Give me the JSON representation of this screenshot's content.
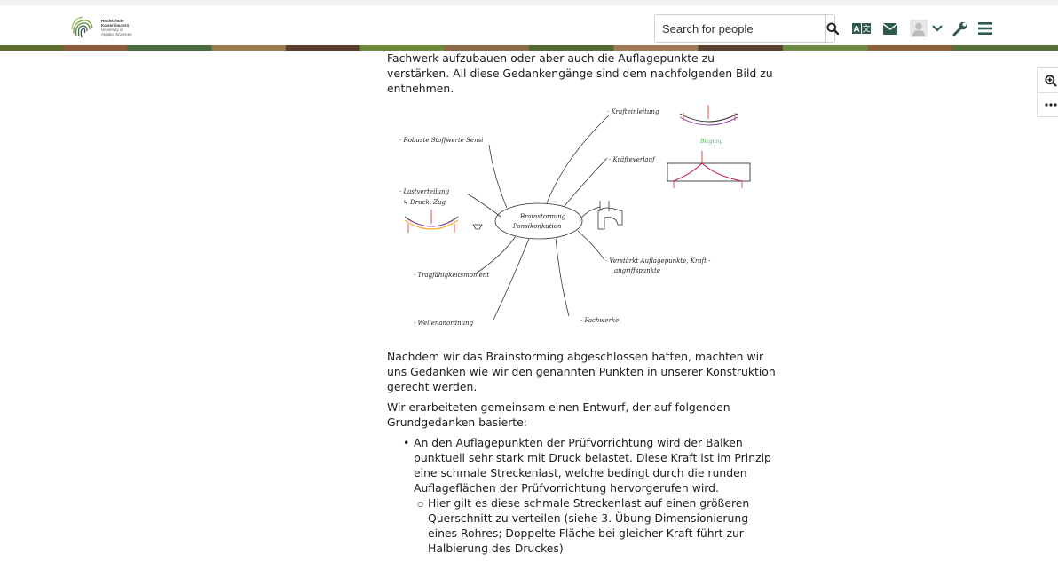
{
  "header": {
    "logo_lines": [
      "Hochschule",
      "Kaiserslautern",
      "University of",
      "Applied Sciences"
    ],
    "search": {
      "placeholder": "Search for people"
    }
  },
  "icons": {
    "search_button": "search-icon",
    "translate": "translate-icon",
    "messages": "envelope-icon",
    "user": "user-avatar-icon",
    "user_menu": "chevron-down-icon",
    "tools": "wrench-icon",
    "menu": "hamburger-menu-icon",
    "zoom": "zoom-in-icon",
    "more": "more-dots-icon"
  },
  "colors": {
    "deco_band": "#5d6b2c",
    "logo_green": "#7aa640"
  },
  "content": {
    "intro": "Fachwerk aufzubauen oder aber auch die Auflagepunkte zu verstärken. All diese Gedankengänge sind dem nachfolgenden Bild zu entnehmen.",
    "sketch": {
      "center": [
        "Brainstorming",
        "Ponsikonkution"
      ],
      "nodes": {
        "n1": "· Robuste Stoffwerte Sensi",
        "n2": "· Krafteinleitung",
        "n3": "· Kräfteverlauf",
        "n4": "· Lastverteilung",
        "n5": "↳ Druck, Zug",
        "n6": "· Verstärkt Auflagepunkte, Kraft -",
        "n7": "angriffspunkte",
        "n8": "· Tragfähigkeitsmoment",
        "n9": "· Wellenanordnung",
        "n10": "· Fachwerke"
      },
      "green_label": "Biegung"
    },
    "p2": "Nachdem wir das Brainstorming abgeschlossen hatten, machten wir uns Gedanken wie wir den genannten Punkten in unserer Konstruktion gerecht werden.",
    "p3": "Wir erarbeiteten gemeinsam einen Entwurf, der auf folgenden Grundgedanken basierte:",
    "bullet1": "An den Auflagepunkten der Prüfvorrichtung wird der Balken punktuell sehr stark mit Druck belastet. Diese Kraft ist im Prinzip eine schmale Streckenlast, welche bedingt durch die runden Auflageflächen der Prüfvorrichtung hervorgerufen wird.",
    "sub1": "Hier gilt es diese schmale Streckenlast auf einen größeren Querschnitt zu verteilen (siehe 3. Übung Dimensionierung eines Rohres; Doppelte Fläche bei gleicher Kraft führt zur Halbierung des Druckes)"
  }
}
